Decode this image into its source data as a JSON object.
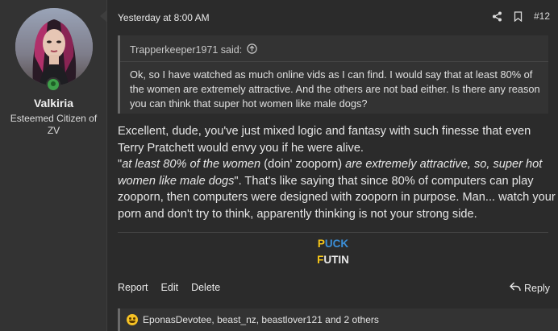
{
  "user": {
    "name": "Valkiria",
    "title": "Esteemed Citizen of ZV"
  },
  "post": {
    "date": "Yesterday at 8:00 AM",
    "number": "#12",
    "quote": {
      "author_line": "Trapperkeeper1971 said:",
      "text": "Ok, so I have watched as much online vids as I can find. I would say that at least 80% of the women are extremely attractive. And the others are not bad either. Is there any reason you can think that super hot women like male dogs?"
    },
    "body": {
      "p1": "Excellent, dude, you've just mixed logic and fantasy with such finesse that even Terry Pratchett would envy you if he were alive.",
      "q_open": "\"",
      "q_italic1": "at least 80% of the women",
      "q_plain": " (doin' zooporn) ",
      "q_italic2": "are extremely attractive, so, super hot women like male dogs",
      "p2": "\". That's like saying that since 80% of computers can play zooporn, then computers were designed with zooporn in purpose. Man... watch your porn and don't try to think, apparently thinking is not your strong side."
    },
    "signature": {
      "line1_first": "P",
      "line1_rest": "UCK",
      "line2_first": "F",
      "line2_rest": "UTIN"
    },
    "actions": {
      "report": "Report",
      "edit": "Edit",
      "delete": "Delete",
      "reply": "Reply"
    },
    "reactions": "EponasDevotee, beast_nz, beastlover121 and 2 others"
  },
  "icons": [
    "share-icon",
    "bookmark-icon",
    "up-arrow-icon",
    "reply-icon",
    "laughing-emoji-icon"
  ]
}
